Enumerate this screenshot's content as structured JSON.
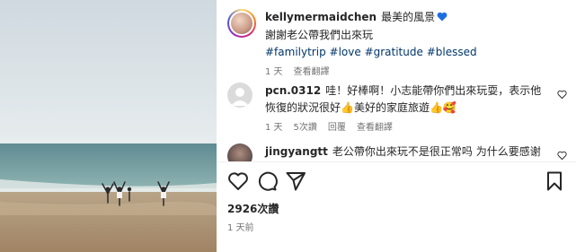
{
  "post": {
    "author": "kellymermaidchen",
    "caption_line1": "最美的風景",
    "caption_line2": "謝謝老公帶我們出來玩",
    "hashtags": [
      "#familytrip",
      "#love",
      "#gratitude",
      "#blessed"
    ],
    "age": "1 天",
    "translate": "查看翻譯"
  },
  "comments": [
    {
      "username": "pcn.0312",
      "text": "哇！好棒啊！小志能帶你們出來玩耍，表示他恢復的狀況很好👍美好的家庭旅遊👍🥰",
      "age": "1 天",
      "likes": "5次讚",
      "reply": "回覆",
      "translate": "查看翻譯"
    },
    {
      "username": "jingyangtt",
      "text": "老公帶你出來玩不是很正常吗 为什么要感谢"
    }
  ],
  "likes_count": "2926次讚",
  "posted_time": "1 天前",
  "icons": [
    "heart-outline-icon",
    "comment-icon",
    "share-icon",
    "bookmark-icon",
    "blue-heart-emoji"
  ],
  "colors": {
    "hashtag": "#00376b",
    "meta": "#737373",
    "blue_heart": "#1d6fe0"
  }
}
